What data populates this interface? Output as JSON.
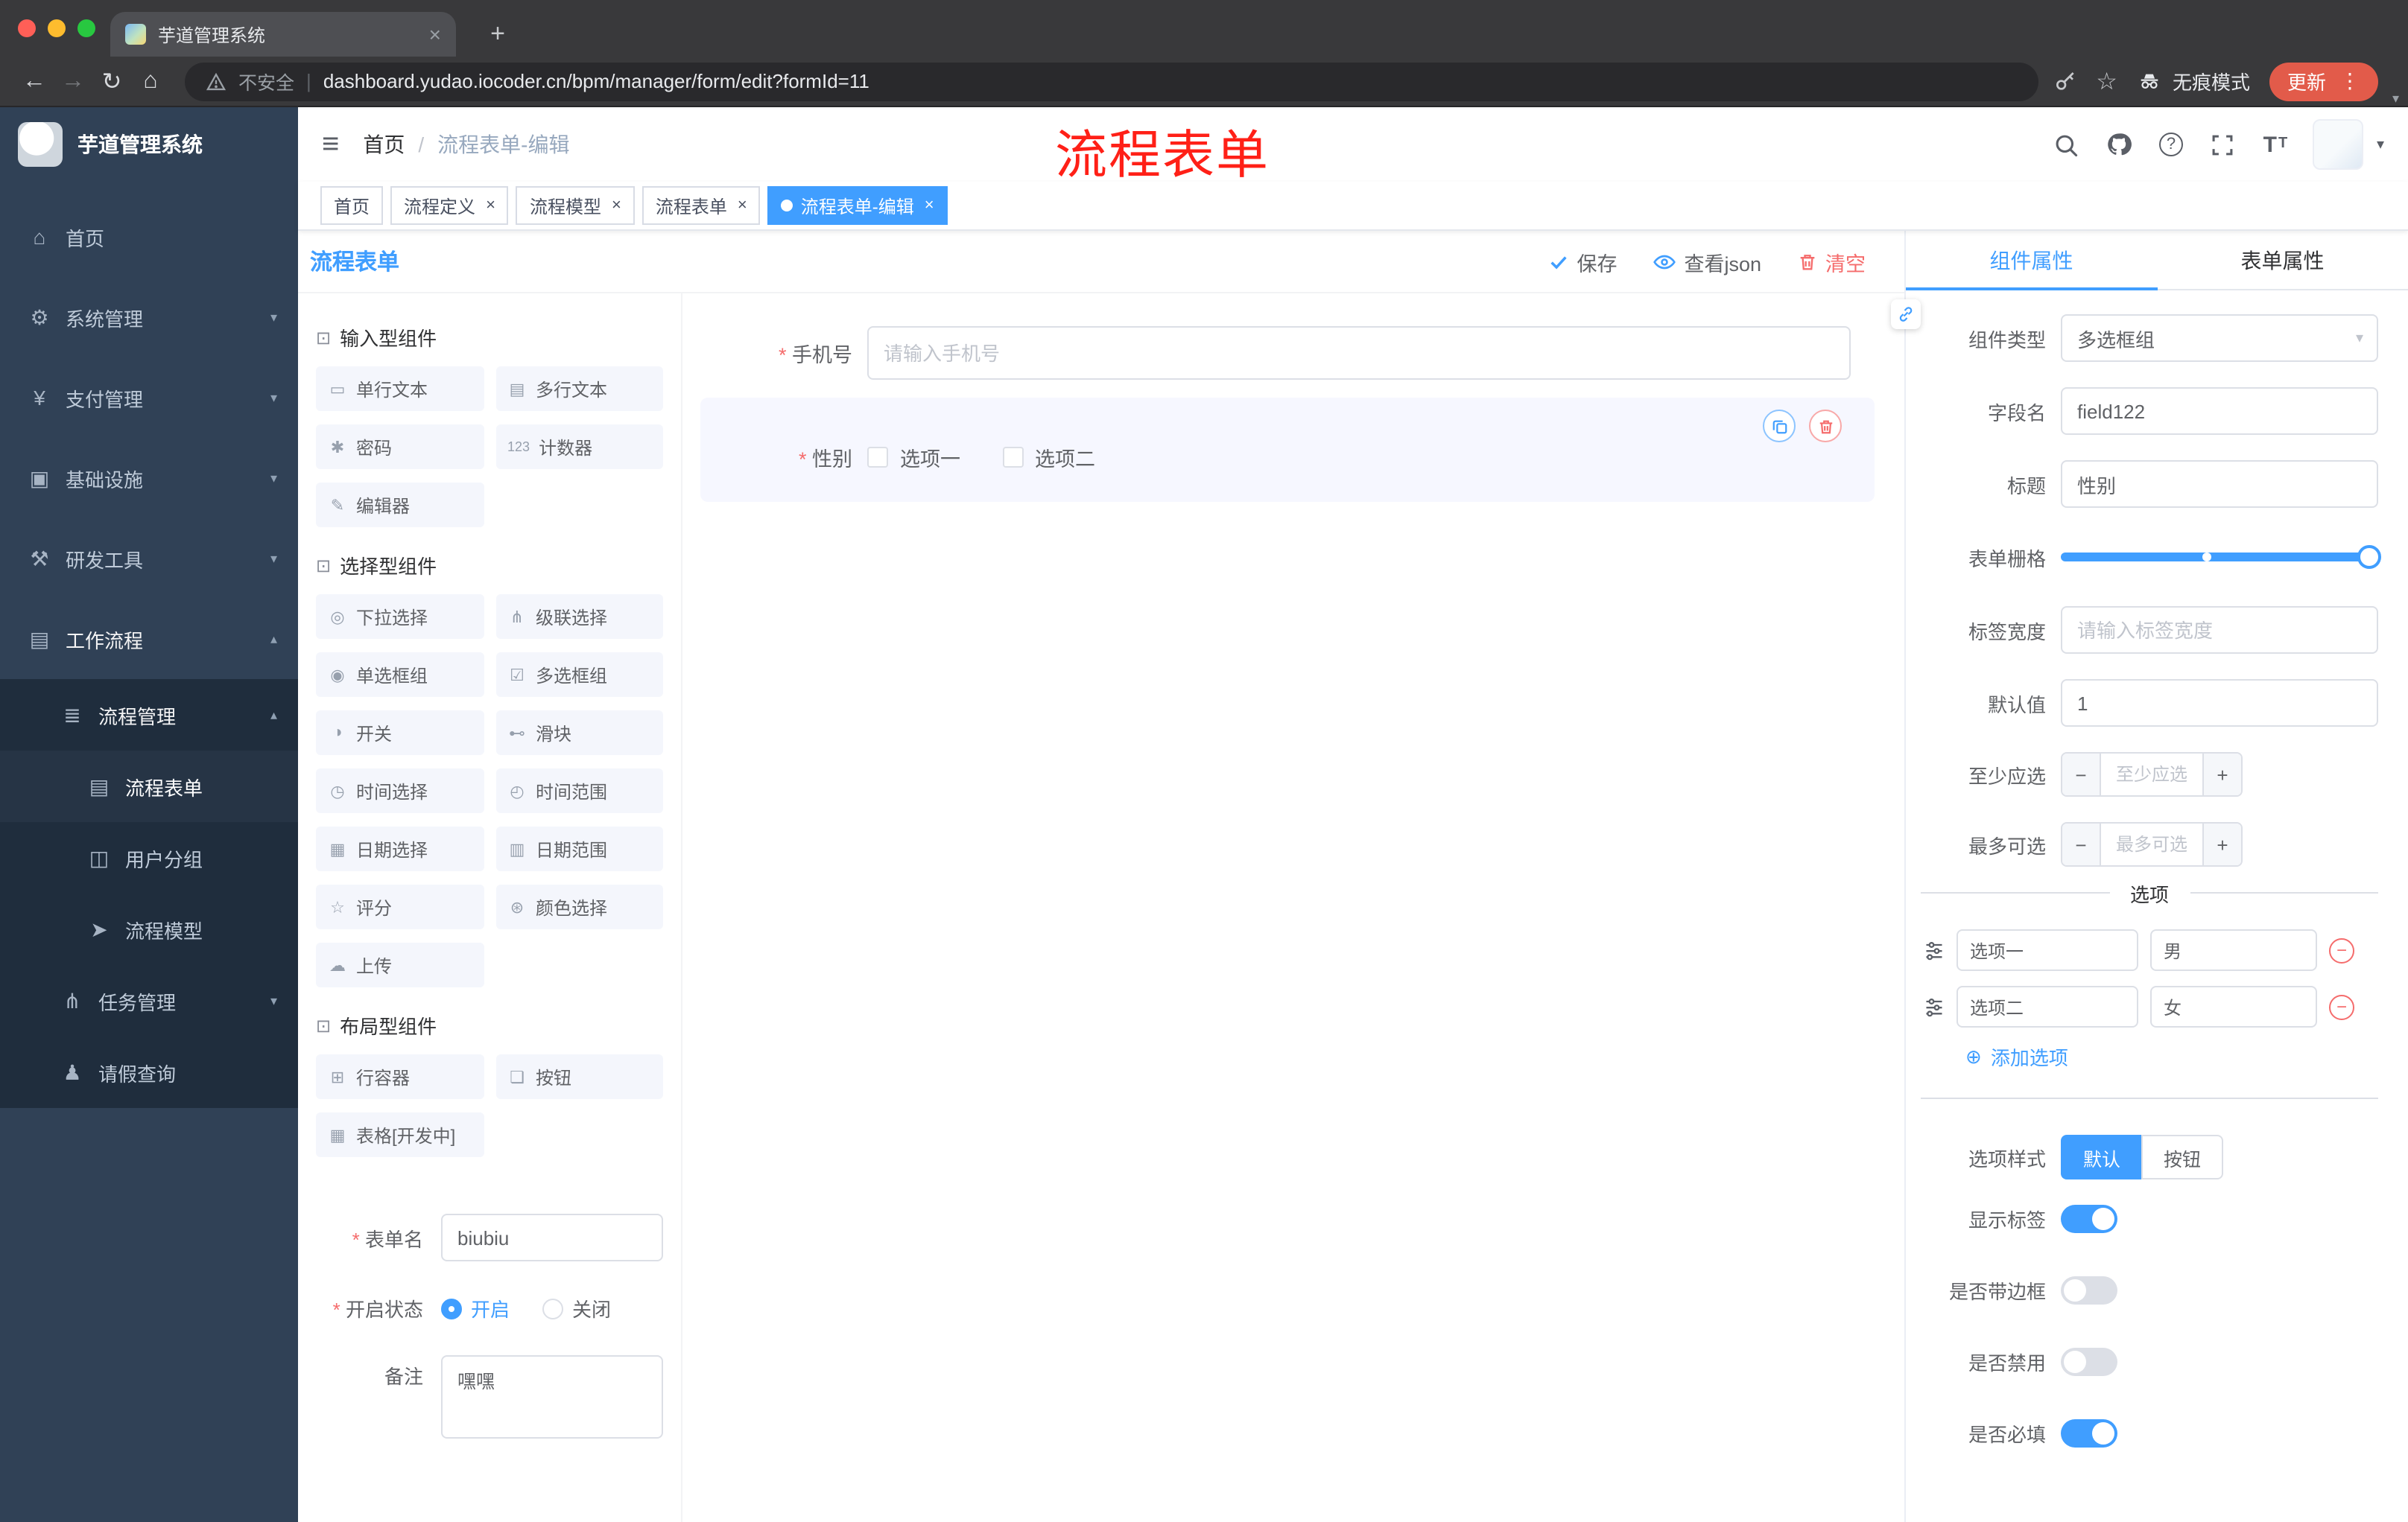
{
  "browser": {
    "tab": {
      "title": "芋道管理系统",
      "close_icon": "×"
    },
    "new_tab_icon": "+",
    "nav": {
      "back": "←",
      "forward": "→",
      "reload": "↻",
      "home": "⌂"
    },
    "address": {
      "security": "不安全",
      "separator": "|",
      "url": "dashboard.yudao.iocoder.cn/bpm/manager/form/edit?formId=11"
    },
    "right": {
      "star_icon": "☆",
      "incognito": "无痕模式",
      "update": "更新",
      "menu_icon": "⋮",
      "caret_icon": "▾"
    }
  },
  "sidebar": {
    "brand": "芋道管理系统",
    "items": [
      {
        "icon": "⌂",
        "label": "首页"
      },
      {
        "icon": "⚙",
        "label": "系统管理",
        "arrow": "▾"
      },
      {
        "icon": "¥",
        "label": "支付管理",
        "arrow": "▾"
      },
      {
        "icon": "▣",
        "label": "基础设施",
        "arrow": "▾"
      },
      {
        "icon": "⚒",
        "label": "研发工具",
        "arrow": "▾"
      },
      {
        "icon": "▤",
        "label": "工作流程",
        "arrow": "▴"
      },
      {
        "icon": "≣",
        "label": "流程管理",
        "arrow": "▴"
      },
      {
        "icon": "▤",
        "label": "流程表单"
      },
      {
        "icon": "◫",
        "label": "用户分组"
      },
      {
        "icon": "➤",
        "label": "流程模型"
      },
      {
        "icon": "⋔",
        "label": "任务管理",
        "arrow": "▾"
      },
      {
        "icon": "♟",
        "label": "请假查询"
      }
    ]
  },
  "header": {
    "menu_icon": "≡",
    "breadcrumb": {
      "home": "首页",
      "separator": "/",
      "current": "流程表单-编辑"
    },
    "annotation": "流程表单",
    "help_icon": "?",
    "fontsize_icon": "T",
    "avatar_caret": "▾"
  },
  "tags": [
    {
      "label": "首页",
      "closable": false,
      "active": false
    },
    {
      "label": "流程定义",
      "closable": true,
      "active": false,
      "close_icon": "×"
    },
    {
      "label": "流程模型",
      "closable": true,
      "active": false,
      "close_icon": "×"
    },
    {
      "label": "流程表单",
      "closable": true,
      "active": false,
      "close_icon": "×"
    },
    {
      "label": "流程表单-编辑",
      "closable": true,
      "active": true,
      "close_icon": "×"
    }
  ],
  "toolbar": {
    "title": "流程表单",
    "save": "保存",
    "view_json": "查看json",
    "clear": "清空"
  },
  "palette": {
    "groups": [
      {
        "icon": "⊡",
        "title": "输入型组件",
        "items": [
          {
            "icon": "▭",
            "label": "单行文本"
          },
          {
            "icon": "▤",
            "label": "多行文本"
          },
          {
            "icon": "✱",
            "label": "密码"
          },
          {
            "icon": "123",
            "label": "计数器"
          },
          {
            "icon": "✎",
            "label": "编辑器"
          }
        ]
      },
      {
        "icon": "⊡",
        "title": "选择型组件",
        "items": [
          {
            "icon": "◎",
            "label": "下拉选择"
          },
          {
            "icon": "⋔",
            "label": "级联选择"
          },
          {
            "icon": "◉",
            "label": "单选框组"
          },
          {
            "icon": "☑",
            "label": "多选框组"
          },
          {
            "icon": "◑",
            "label": "开关"
          },
          {
            "icon": "⊷",
            "label": "滑块"
          },
          {
            "icon": "◷",
            "label": "时间选择"
          },
          {
            "icon": "◴",
            "label": "时间范围"
          },
          {
            "icon": "▦",
            "label": "日期选择"
          },
          {
            "icon": "▥",
            "label": "日期范围"
          },
          {
            "icon": "☆",
            "label": "评分"
          },
          {
            "icon": "⊛",
            "label": "颜色选择"
          },
          {
            "icon": "☁",
            "label": "上传"
          }
        ]
      },
      {
        "icon": "⊡",
        "title": "布局型组件",
        "items": [
          {
            "icon": "⊞",
            "label": "行容器"
          },
          {
            "icon": "❏",
            "label": "按钮"
          },
          {
            "icon": "▦",
            "label": "表格[开发中]"
          }
        ]
      }
    ]
  },
  "meta": {
    "name_label": "表单名",
    "name_value": "biubiu",
    "status_label": "开启状态",
    "status_on": "开启",
    "status_off": "关闭",
    "status_selected": "开启",
    "remark_label": "备注",
    "remark_value": "嘿嘿"
  },
  "canvas": {
    "phone": {
      "label": "手机号",
      "placeholder": "请输入手机号",
      "required": true
    },
    "gender": {
      "label": "性别",
      "required": true,
      "options": [
        "选项一",
        "选项二"
      ],
      "selected": true
    }
  },
  "props": {
    "tabs": [
      "组件属性",
      "表单属性"
    ],
    "component_type": {
      "label": "组件类型",
      "value": "多选框组",
      "caret": "▾"
    },
    "field_name": {
      "label": "字段名",
      "value": "field122"
    },
    "title": {
      "label": "标题",
      "value": "性别"
    },
    "grid": {
      "label": "表单栅格",
      "value": 24,
      "max": 24,
      "mark_percent": 46
    },
    "label_width": {
      "label": "标签宽度",
      "placeholder": "请输入标签宽度"
    },
    "default_value": {
      "label": "默认值",
      "value": "1"
    },
    "min_select": {
      "label": "至少应选",
      "placeholder": "至少应选",
      "minus": "−",
      "plus": "+"
    },
    "max_select": {
      "label": "最多可选",
      "placeholder": "最多可选",
      "minus": "−",
      "plus": "+"
    },
    "options": {
      "title": "选项",
      "rows": [
        {
          "label": "选项一",
          "value": "男",
          "remove_icon": "−"
        },
        {
          "label": "选项二",
          "value": "女",
          "remove_icon": "−"
        }
      ],
      "add_icon": "⊕",
      "add_label": "添加选项"
    },
    "style": {
      "label": "选项样式",
      "options": [
        "默认",
        "按钮"
      ],
      "selected": "默认"
    },
    "switches": [
      {
        "label": "显示标签",
        "on": true
      },
      {
        "label": "是否带边框",
        "on": false
      },
      {
        "label": "是否禁用",
        "on": false
      },
      {
        "label": "是否必填",
        "on": true
      }
    ]
  },
  "colors": {
    "primary": "#409eff",
    "danger": "#f56c6c",
    "sidebar_bg": "#304156",
    "submenu_bg": "#1f2d3d",
    "active_tag": "#409eff",
    "update_pill": "#e25b4a",
    "annotation": "#ff2017"
  }
}
